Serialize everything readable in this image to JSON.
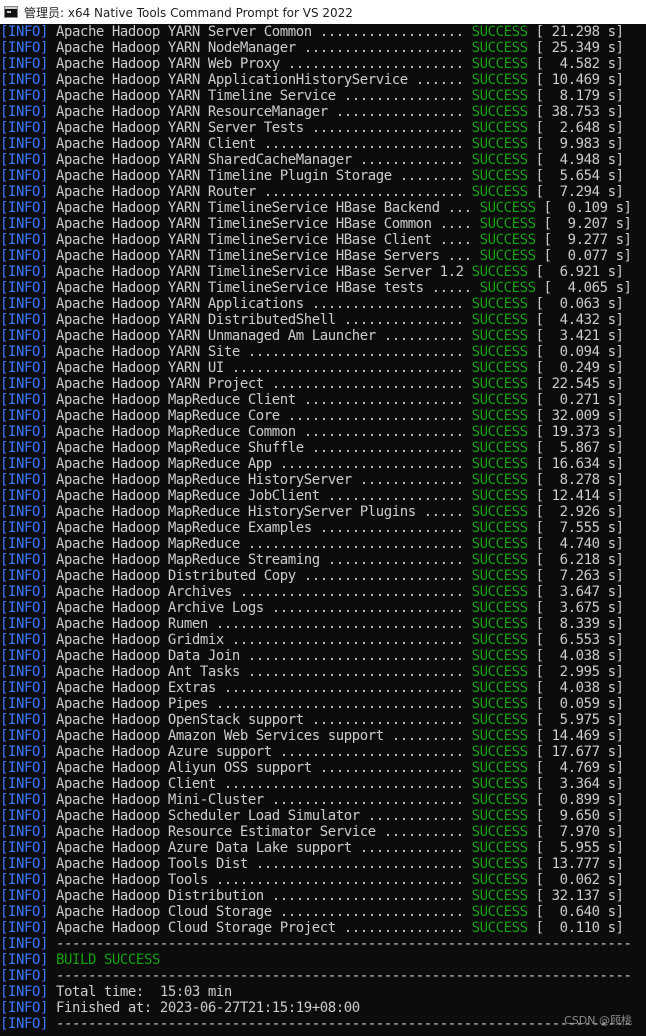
{
  "window": {
    "title": "管理员: x64 Native Tools Command Prompt for VS 2022"
  },
  "colors": {
    "background": "#0c0c0c",
    "text": "#cccccc",
    "info_tag": "#3b78ff",
    "success": "#13a10e",
    "titlebar": "#ffffff"
  },
  "console": {
    "info_tag": "[INFO]",
    "modules": [
      {
        "name": "Apache Hadoop YARN Server Common",
        "dots": " ..................",
        "status": "SUCCESS",
        "time": "[ 21.298 s]"
      },
      {
        "name": "Apache Hadoop YARN NodeManager",
        "dots": " ....................",
        "status": "SUCCESS",
        "time": "[ 25.349 s]"
      },
      {
        "name": "Apache Hadoop YARN Web Proxy",
        "dots": " ......................",
        "status": "SUCCESS",
        "time": "[  4.582 s]"
      },
      {
        "name": "Apache Hadoop YARN ApplicationHistoryService",
        "dots": " ......",
        "status": "SUCCESS",
        "time": "[ 10.469 s]"
      },
      {
        "name": "Apache Hadoop YARN Timeline Service",
        "dots": " ...............",
        "status": "SUCCESS",
        "time": "[  8.179 s]"
      },
      {
        "name": "Apache Hadoop YARN ResourceManager",
        "dots": " ................",
        "status": "SUCCESS",
        "time": "[ 38.753 s]"
      },
      {
        "name": "Apache Hadoop YARN Server Tests",
        "dots": " ...................",
        "status": "SUCCESS",
        "time": "[  2.648 s]"
      },
      {
        "name": "Apache Hadoop YARN Client",
        "dots": " .........................",
        "status": "SUCCESS",
        "time": "[  9.983 s]"
      },
      {
        "name": "Apache Hadoop YARN SharedCacheManager",
        "dots": " .............",
        "status": "SUCCESS",
        "time": "[  4.948 s]"
      },
      {
        "name": "Apache Hadoop YARN Timeline Plugin Storage",
        "dots": " ........",
        "status": "SUCCESS",
        "time": "[  5.654 s]"
      },
      {
        "name": "Apache Hadoop YARN Router",
        "dots": " .........................",
        "status": "SUCCESS",
        "time": "[  7.294 s]"
      },
      {
        "name": "Apache Hadoop YARN TimelineService HBase Backend",
        "dots": " ...",
        "status": "SUCCESS",
        "time": "[  0.109 s]"
      },
      {
        "name": "Apache Hadoop YARN TimelineService HBase Common",
        "dots": " ....",
        "status": "SUCCESS",
        "time": "[  9.207 s]"
      },
      {
        "name": "Apache Hadoop YARN TimelineService HBase Client",
        "dots": " ....",
        "status": "SUCCESS",
        "time": "[  9.277 s]"
      },
      {
        "name": "Apache Hadoop YARN TimelineService HBase Servers",
        "dots": " ...",
        "status": "SUCCESS",
        "time": "[  0.077 s]"
      },
      {
        "name": "Apache Hadoop YARN TimelineService HBase Server 1.2",
        "dots": "",
        "status": "SUCCESS",
        "time": "[  6.921 s]"
      },
      {
        "name": "Apache Hadoop YARN TimelineService HBase tests",
        "dots": " .....",
        "status": "SUCCESS",
        "time": "[  4.065 s]"
      },
      {
        "name": "Apache Hadoop YARN Applications",
        "dots": " ...................",
        "status": "SUCCESS",
        "time": "[  0.063 s]"
      },
      {
        "name": "Apache Hadoop YARN DistributedShell",
        "dots": " ...............",
        "status": "SUCCESS",
        "time": "[  4.432 s]"
      },
      {
        "name": "Apache Hadoop YARN Unmanaged Am Launcher",
        "dots": " ..........",
        "status": "SUCCESS",
        "time": "[  3.421 s]"
      },
      {
        "name": "Apache Hadoop YARN Site",
        "dots": " ...........................",
        "status": "SUCCESS",
        "time": "[  0.094 s]"
      },
      {
        "name": "Apache Hadoop YARN UI",
        "dots": " .............................",
        "status": "SUCCESS",
        "time": "[  0.249 s]"
      },
      {
        "name": "Apache Hadoop YARN Project",
        "dots": " ........................",
        "status": "SUCCESS",
        "time": "[ 22.545 s]"
      },
      {
        "name": "Apache Hadoop MapReduce Client",
        "dots": " ....................",
        "status": "SUCCESS",
        "time": "[  0.271 s]"
      },
      {
        "name": "Apache Hadoop MapReduce Core",
        "dots": " ......................",
        "status": "SUCCESS",
        "time": "[ 32.009 s]"
      },
      {
        "name": "Apache Hadoop MapReduce Common",
        "dots": " ....................",
        "status": "SUCCESS",
        "time": "[ 19.373 s]"
      },
      {
        "name": "Apache Hadoop MapReduce Shuffle",
        "dots": " ...................",
        "status": "SUCCESS",
        "time": "[  5.867 s]"
      },
      {
        "name": "Apache Hadoop MapReduce App",
        "dots": " .......................",
        "status": "SUCCESS",
        "time": "[ 16.634 s]"
      },
      {
        "name": "Apache Hadoop MapReduce HistoryServer",
        "dots": " .............",
        "status": "SUCCESS",
        "time": "[  8.278 s]"
      },
      {
        "name": "Apache Hadoop MapReduce JobClient",
        "dots": " .................",
        "status": "SUCCESS",
        "time": "[ 12.414 s]"
      },
      {
        "name": "Apache Hadoop MapReduce HistoryServer Plugins",
        "dots": " .....",
        "status": "SUCCESS",
        "time": "[  2.926 s]"
      },
      {
        "name": "Apache Hadoop MapReduce Examples",
        "dots": " ..................",
        "status": "SUCCESS",
        "time": "[  7.555 s]"
      },
      {
        "name": "Apache Hadoop MapReduce",
        "dots": " ...........................",
        "status": "SUCCESS",
        "time": "[  4.740 s]"
      },
      {
        "name": "Apache Hadoop MapReduce Streaming",
        "dots": " .................",
        "status": "SUCCESS",
        "time": "[  6.218 s]"
      },
      {
        "name": "Apache Hadoop Distributed Copy",
        "dots": " ....................",
        "status": "SUCCESS",
        "time": "[  7.263 s]"
      },
      {
        "name": "Apache Hadoop Archives",
        "dots": " ............................",
        "status": "SUCCESS",
        "time": "[  3.647 s]"
      },
      {
        "name": "Apache Hadoop Archive Logs",
        "dots": " ........................",
        "status": "SUCCESS",
        "time": "[  3.675 s]"
      },
      {
        "name": "Apache Hadoop Rumen",
        "dots": " ...............................",
        "status": "SUCCESS",
        "time": "[  8.339 s]"
      },
      {
        "name": "Apache Hadoop Gridmix",
        "dots": " .............................",
        "status": "SUCCESS",
        "time": "[  6.553 s]"
      },
      {
        "name": "Apache Hadoop Data Join",
        "dots": " ...........................",
        "status": "SUCCESS",
        "time": "[  4.038 s]"
      },
      {
        "name": "Apache Hadoop Ant Tasks",
        "dots": " ...........................",
        "status": "SUCCESS",
        "time": "[  2.995 s]"
      },
      {
        "name": "Apache Hadoop Extras",
        "dots": " ..............................",
        "status": "SUCCESS",
        "time": "[  4.038 s]"
      },
      {
        "name": "Apache Hadoop Pipes",
        "dots": " ...............................",
        "status": "SUCCESS",
        "time": "[  0.059 s]"
      },
      {
        "name": "Apache Hadoop OpenStack support",
        "dots": " ...................",
        "status": "SUCCESS",
        "time": "[  5.975 s]"
      },
      {
        "name": "Apache Hadoop Amazon Web Services support",
        "dots": " .........",
        "status": "SUCCESS",
        "time": "[ 14.469 s]"
      },
      {
        "name": "Apache Hadoop Azure support",
        "dots": " .......................",
        "status": "SUCCESS",
        "time": "[ 17.677 s]"
      },
      {
        "name": "Apache Hadoop Aliyun OSS support",
        "dots": " ..................",
        "status": "SUCCESS",
        "time": "[  4.769 s]"
      },
      {
        "name": "Apache Hadoop Client",
        "dots": " ..............................",
        "status": "SUCCESS",
        "time": "[  3.364 s]"
      },
      {
        "name": "Apache Hadoop Mini-Cluster",
        "dots": " ........................",
        "status": "SUCCESS",
        "time": "[  0.899 s]"
      },
      {
        "name": "Apache Hadoop Scheduler Load Simulator",
        "dots": " ............",
        "status": "SUCCESS",
        "time": "[  9.650 s]"
      },
      {
        "name": "Apache Hadoop Resource Estimator Service",
        "dots": " ..........",
        "status": "SUCCESS",
        "time": "[  7.970 s]"
      },
      {
        "name": "Apache Hadoop Azure Data Lake support",
        "dots": " .............",
        "status": "SUCCESS",
        "time": "[  5.955 s]"
      },
      {
        "name": "Apache Hadoop Tools Dist",
        "dots": " ..........................",
        "status": "SUCCESS",
        "time": "[ 13.777 s]"
      },
      {
        "name": "Apache Hadoop Tools",
        "dots": " ...............................",
        "status": "SUCCESS",
        "time": "[  0.062 s]"
      },
      {
        "name": "Apache Hadoop Distribution",
        "dots": " ........................",
        "status": "SUCCESS",
        "time": "[ 32.137 s]"
      },
      {
        "name": "Apache Hadoop Cloud Storage",
        "dots": " .......................",
        "status": "SUCCESS",
        "time": "[  0.640 s]"
      },
      {
        "name": "Apache Hadoop Cloud Storage Project",
        "dots": " ...............",
        "status": "SUCCESS",
        "time": "[  0.110 s]"
      }
    ],
    "separator": "------------------------------------------------------------------------",
    "build_result": "BUILD SUCCESS",
    "total_time": "Total time:  15:03 min",
    "finished_at": "Finished at: 2023-06-27T21:15:19+08:00"
  },
  "watermark": "CSDN @顾桃"
}
